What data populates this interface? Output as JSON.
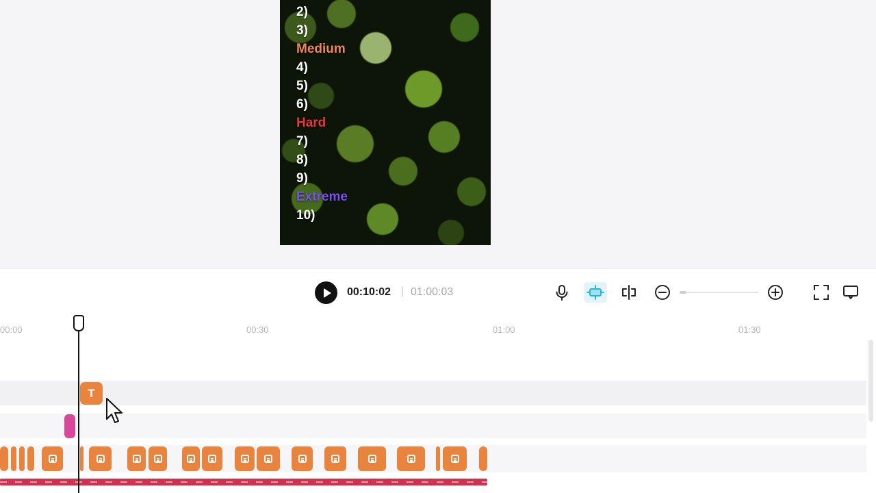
{
  "preview": {
    "list": [
      {
        "text": "2)",
        "style": "plain"
      },
      {
        "text": "3)",
        "style": "plain"
      },
      {
        "text": "Medium",
        "style": "medium"
      },
      {
        "text": "4)",
        "style": "plain"
      },
      {
        "text": "5)",
        "style": "plain"
      },
      {
        "text": "6)",
        "style": "plain"
      },
      {
        "text": "Hard",
        "style": "hard"
      },
      {
        "text": "7)",
        "style": "plain"
      },
      {
        "text": "8)",
        "style": "plain"
      },
      {
        "text": "9)",
        "style": "plain"
      },
      {
        "text": "Extreme",
        "style": "extreme"
      },
      {
        "text": "10)",
        "style": "plain"
      }
    ]
  },
  "controls": {
    "time_current": "00:10:02",
    "time_separator": "|",
    "time_total": "01:00:03",
    "icons": [
      "play-icon",
      "microphone-icon",
      "scene-detect-icon",
      "split-icon",
      "zoom-out-icon",
      "zoom-in-icon",
      "fullscreen-icon",
      "screen-icon"
    ]
  },
  "timeline": {
    "ruler": [
      "00:00",
      "00:30",
      "01:00",
      "01:30"
    ],
    "text_clip_label": "T"
  },
  "colors": {
    "clip_orange": "#e8843e",
    "audio_pink": "#d9479a",
    "caption_red": "#d0314f",
    "medium": "#f0845a",
    "hard": "#e8343f",
    "extreme": "#7a4ff0",
    "accent_cyan": "#27b7d6"
  }
}
